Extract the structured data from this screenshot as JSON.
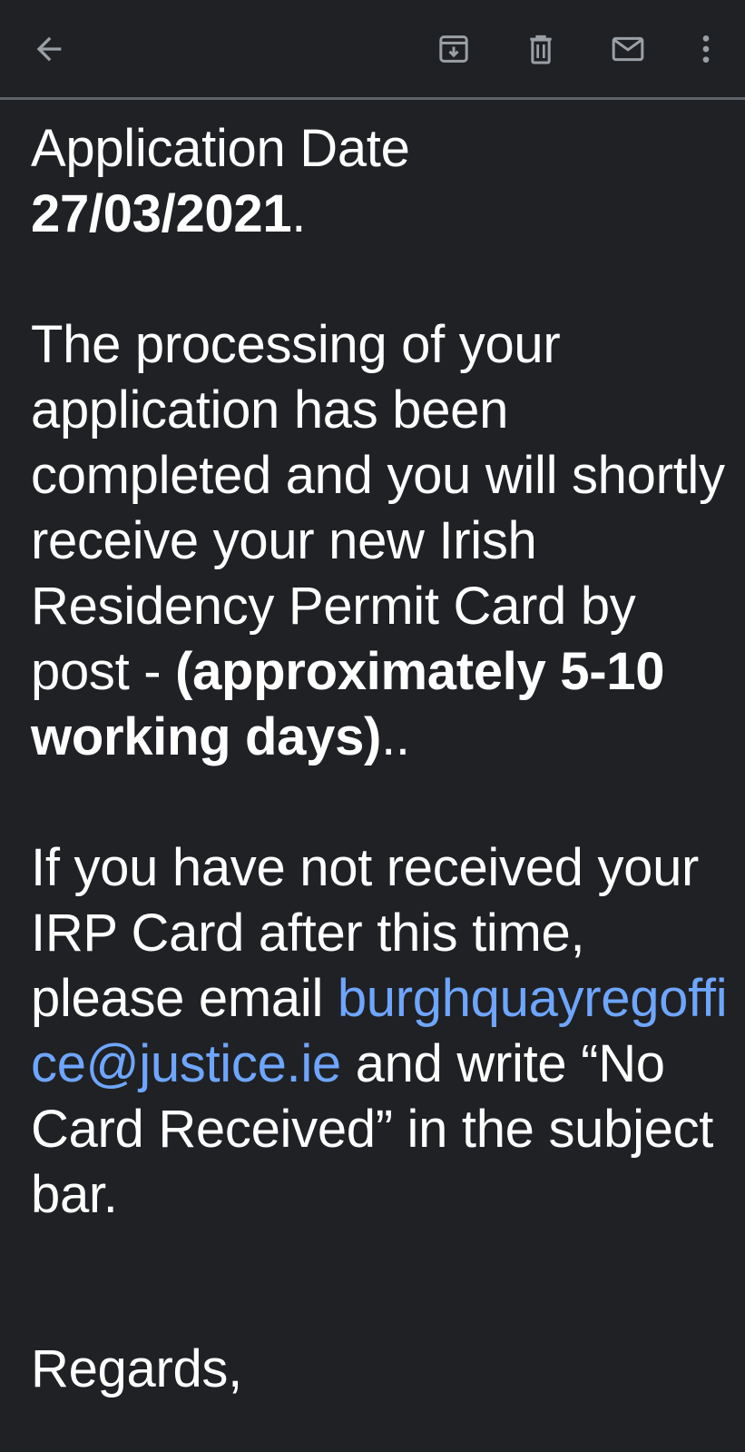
{
  "toolbar": {
    "back_icon": "arrow-back-icon",
    "archive_icon": "archive-icon",
    "delete_icon": "trash-icon",
    "mark_unread_icon": "mail-icon",
    "more_icon": "more-vert-icon"
  },
  "email": {
    "application_date_label": "Application Date",
    "application_date_value": "27/03/2021",
    "date_suffix": ".",
    "processing_text": "The processing of your application has been completed and you will shortly receive your new Irish Residency Permit Card by post - ",
    "processing_bold": "(approximately 5-10 working days)",
    "processing_suffix": "..",
    "not_received_text": "If you have not received your IRP Card after this time, please email ",
    "email_link": "burghquayregoffice@justice.ie",
    "not_received_suffix": " and write “No Card Received” in the subject bar.",
    "closing": "Regards,"
  },
  "colors": {
    "background": "#202124",
    "text": "#ffffff",
    "link": "#6ea6ff",
    "divider": "#5f6368"
  }
}
